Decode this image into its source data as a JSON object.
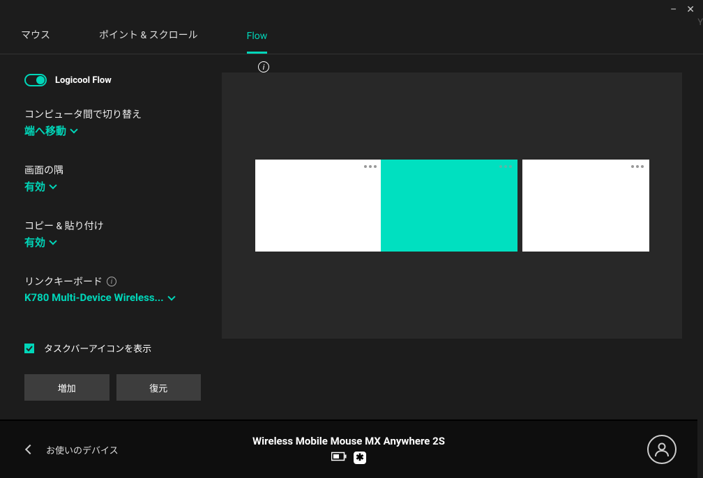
{
  "window": {
    "minimize": "–",
    "close": "✕",
    "edge_char": "Y"
  },
  "tabs": {
    "mouse": "マウス",
    "point_scroll": "ポイント & スクロール",
    "flow": "Flow"
  },
  "sidebar": {
    "flow_toggle_label": "Logicool Flow",
    "switch_computers": {
      "label": "コンピュータ間で切り替え",
      "value": "端へ移動"
    },
    "screen_edge": {
      "label": "画面の隅",
      "value": "有効"
    },
    "copy_paste": {
      "label": "コピー & 貼り付け",
      "value": "有効"
    },
    "linked_keyboard": {
      "label": "リンクキーボード",
      "value": "K780 Multi-Device Wireless..."
    },
    "show_taskbar_icon": "タスクバーアイコンを表示",
    "btn_add": "増加",
    "btn_restore": "復元"
  },
  "bottom": {
    "your_devices": "お使いのデバイス",
    "device_name": "Wireless Mobile Mouse MX Anywhere 2S",
    "unifying_glyph": "✱"
  }
}
